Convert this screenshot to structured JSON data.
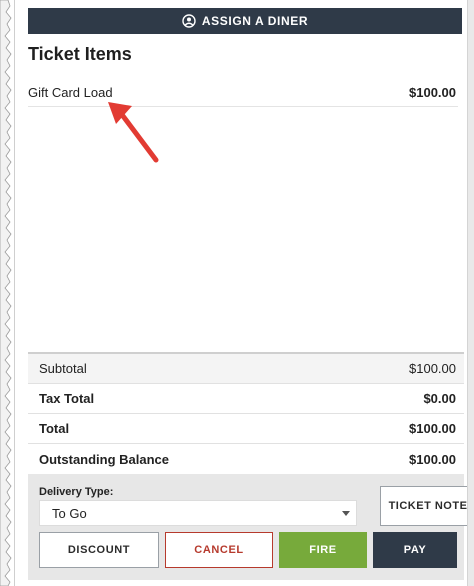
{
  "header": {
    "assign_label": "ASSIGN A DINER",
    "assign_icon": "user-circle-icon"
  },
  "ticket": {
    "title": "Ticket Items",
    "items": [
      {
        "name": "Gift Card Load",
        "price": "$100.00"
      }
    ]
  },
  "annotation": {
    "icon": "red-arrow-icon",
    "color": "#e23b33"
  },
  "totals": {
    "subtotal": {
      "label": "Subtotal",
      "value": "$100.00"
    },
    "tax_total": {
      "label": "Tax Total",
      "value": "$0.00"
    },
    "total": {
      "label": "Total",
      "value": "$100.00"
    },
    "outstanding": {
      "label": "Outstanding Balance",
      "value": "$100.00"
    }
  },
  "footer": {
    "delivery_label": "Delivery Type:",
    "delivery_value": "To Go",
    "ticket_note_label": "TICKET NOTE",
    "discount_label": "DISCOUNT",
    "cancel_label": "CANCEL",
    "fire_label": "FIRE",
    "pay_label": "PAY"
  },
  "colors": {
    "dark": "#2f3a48",
    "fire_green": "#77aa3b",
    "cancel_red": "#b63a2d"
  }
}
